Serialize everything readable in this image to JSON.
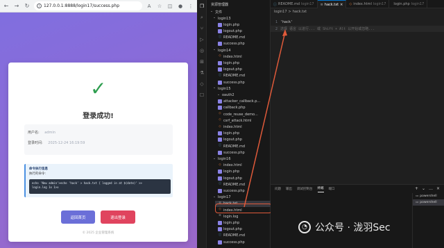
{
  "browser": {
    "url": "127.0.0.1:8888/login17/success.php",
    "card": {
      "title": "登录成功!",
      "check_glyph": "✓",
      "username_label": "用户名:",
      "username_value": "admin",
      "login_time_label": "登录时间:",
      "login_time_value": "2025-12-24 16:19:59",
      "cmd_title": "命令执行信息",
      "cmd_subtitle": "执行的命令:",
      "cmd_text": "echo 'New admin'>echo 'hack' > hack.txt { logged in at $(date)' >>\nlogin.log 1x 1>x",
      "home_button": "返回首页",
      "logout_button": "退出登录",
      "copyright": "© 2025 企业管理系统"
    }
  },
  "vscode": {
    "explorer_title": "资源管理器",
    "workspace_label": "文件",
    "tree": [
      {
        "label": "login13",
        "kind": "folder"
      },
      {
        "label": "login.php",
        "kind": "php"
      },
      {
        "label": "logout.php",
        "kind": "php"
      },
      {
        "label": "README.md",
        "kind": "md"
      },
      {
        "label": "success.php",
        "kind": "php"
      },
      {
        "label": "login14",
        "kind": "folder"
      },
      {
        "label": "index.html",
        "kind": "html"
      },
      {
        "label": "login.php",
        "kind": "php"
      },
      {
        "label": "logout.php",
        "kind": "php"
      },
      {
        "label": "README.md",
        "kind": "md"
      },
      {
        "label": "success.php",
        "kind": "php"
      },
      {
        "label": "login15",
        "kind": "folder"
      },
      {
        "label": "oauth2",
        "kind": "folder"
      },
      {
        "label": "attacker_callback.p...",
        "kind": "php"
      },
      {
        "label": "callback.php",
        "kind": "php"
      },
      {
        "label": "code_reuse_demo...",
        "kind": "html"
      },
      {
        "label": "csrf_attack.html",
        "kind": "html"
      },
      {
        "label": "index.html",
        "kind": "html"
      },
      {
        "label": "login.php",
        "kind": "php"
      },
      {
        "label": "logout.php",
        "kind": "php"
      },
      {
        "label": "README.md",
        "kind": "md"
      },
      {
        "label": "success.php",
        "kind": "php"
      },
      {
        "label": "login16",
        "kind": "folder"
      },
      {
        "label": "index.html",
        "kind": "html"
      },
      {
        "label": "login.php",
        "kind": "php"
      },
      {
        "label": "logout.php",
        "kind": "php"
      },
      {
        "label": "README.md",
        "kind": "md"
      },
      {
        "label": "success.php",
        "kind": "php"
      },
      {
        "label": "login17",
        "kind": "folder"
      },
      {
        "label": "hack.txt",
        "kind": "txt"
      },
      {
        "label": "index.html",
        "kind": "html"
      },
      {
        "label": "login.log",
        "kind": "log"
      },
      {
        "label": "login.php",
        "kind": "php"
      },
      {
        "label": "logout.php",
        "kind": "php"
      },
      {
        "label": "README.md",
        "kind": "md"
      },
      {
        "label": "success.php",
        "kind": "php"
      }
    ],
    "tabs": [
      {
        "label": "README.md",
        "sub": "login17"
      },
      {
        "label": "hack.txt",
        "sub": "",
        "active": true
      },
      {
        "label": "index.html",
        "sub": "login17"
      },
      {
        "label": "login.php",
        "sub": "login17"
      }
    ],
    "breadcrumb": [
      "login17",
      ">",
      "hack.txt"
    ],
    "code_lines": [
      {
        "no": "1",
        "text": "'hack'"
      },
      {
        "no": "2",
        "text": "选择 语言 以进行...  或 Shift + Alt 以开始或忽略..."
      }
    ],
    "panel_tabs": [
      "问题",
      "输出",
      "调试控制台",
      "终端",
      "端口"
    ],
    "panel_active": "终端",
    "terminals": [
      "powershell",
      "powershell"
    ]
  },
  "watermark": {
    "text": "公众号 · 泷羽Sec"
  }
}
